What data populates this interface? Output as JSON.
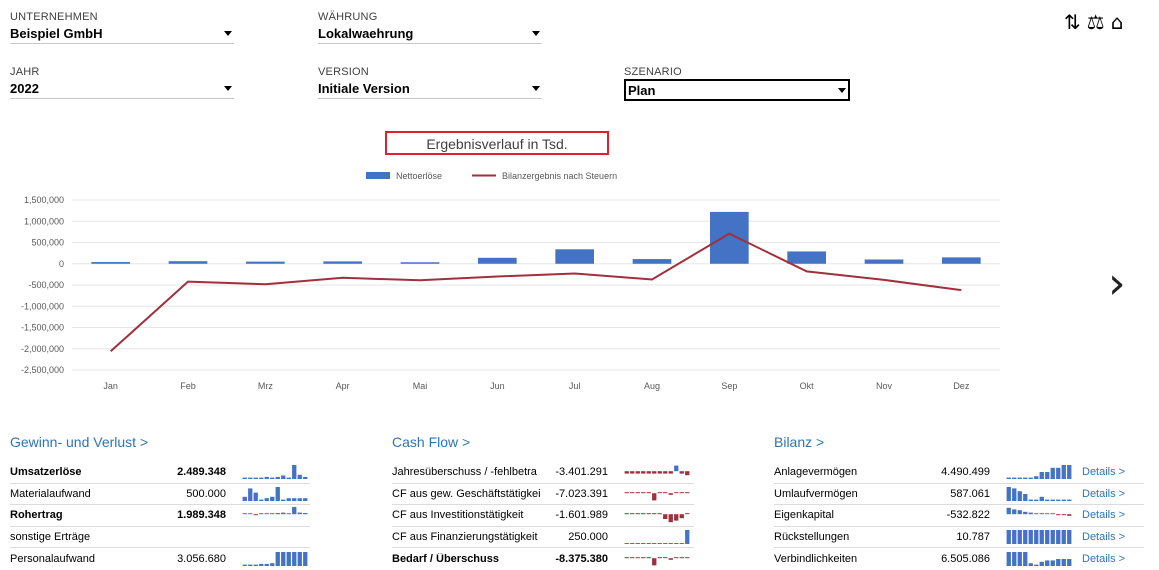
{
  "filters": {
    "unternehmen": {
      "label": "UNTERNEHMEN",
      "value": "Beispiel GmbH"
    },
    "waehrung": {
      "label": "WÄHRUNG",
      "value": "Lokalwaehrung"
    },
    "jahr": {
      "label": "JAHR",
      "value": "2022"
    },
    "version": {
      "label": "VERSION",
      "value": "Initiale Version"
    },
    "szenario": {
      "label": "SZENARIO",
      "value": "Plan"
    }
  },
  "top_icons": [
    "refresh-arrows-icon",
    "balance-scale-icon",
    "home-icon"
  ],
  "nav_next": "›",
  "chart_data": {
    "type": "bar",
    "title": "Ergebnisverlauf in Tsd.",
    "legend_position": "top",
    "categories": [
      "Jan",
      "Feb",
      "Mrz",
      "Apr",
      "Mai",
      "Jun",
      "Jul",
      "Aug",
      "Sep",
      "Okt",
      "Nov",
      "Dez"
    ],
    "y_ticks": [
      "1,500,000",
      "1,000,000",
      "500,000",
      "0",
      "-500,000",
      "-1,000,000",
      "-1,500,000",
      "-2,000,000",
      "-2,500,000"
    ],
    "ylim": [
      -2500000,
      1500000
    ],
    "grid": true,
    "series": [
      {
        "name": "Nettoerlöse",
        "type": "bar",
        "color": "#4472c4",
        "values": [
          40000,
          60000,
          50000,
          55000,
          35000,
          140000,
          340000,
          110000,
          1220000,
          290000,
          100000,
          150000
        ]
      },
      {
        "name": "Bilanzergebnis nach Steuern",
        "type": "line",
        "color": "#a0303c",
        "values": [
          -2060000,
          -420000,
          -480000,
          -330000,
          -390000,
          -300000,
          -230000,
          -370000,
          710000,
          -180000,
          -380000,
          -620000
        ]
      }
    ]
  },
  "sections": {
    "guv": {
      "title": "Gewinn- und Verlust >",
      "rows": [
        {
          "label": "Umsatzerlöse",
          "value": "2.489.348",
          "bold": true,
          "spark": [
            0.1,
            0.1,
            0.1,
            0.1,
            0.15,
            0.1,
            0.15,
            0.25,
            0.1,
            1.0,
            0.3,
            0.15
          ],
          "spark_color": "#4472c4"
        },
        {
          "label": "Materialaufwand",
          "value": "500.000",
          "bold": false,
          "spark": [
            0.3,
            0.9,
            0.6,
            0.1,
            0.2,
            0.3,
            1.0,
            0.1,
            0.2,
            0.2,
            0.2,
            0.2
          ],
          "spark_color": "#4472c4"
        },
        {
          "label": "Rohertrag",
          "value": "1.989.348",
          "bold": true,
          "spark": [
            0.1,
            0.1,
            -0.1,
            0.1,
            0.1,
            0.1,
            0.15,
            0.2,
            0.1,
            1.0,
            0.2,
            0.15
          ],
          "spark_color": "#4472c4"
        },
        {
          "label": "sonstige Erträge",
          "value": "",
          "bold": false,
          "spark": null
        },
        {
          "label": "Personalaufwand",
          "value": "3.056.680",
          "bold": false,
          "spark": [
            0.1,
            0.1,
            0.1,
            0.15,
            0.15,
            0.2,
            1.0,
            1.0,
            1.0,
            1.0,
            1.0,
            1.0
          ],
          "spark_color": "#4472c4"
        }
      ]
    },
    "cashflow": {
      "title": "Cash Flow >",
      "rows": [
        {
          "label": "Jahresüberschuss / -fehlbetra",
          "value": "-3.401.291",
          "bold": false,
          "spark": [
            -0.3,
            -0.3,
            -0.3,
            -0.3,
            -0.3,
            -0.3,
            -0.3,
            -0.3,
            -0.3,
            0.7,
            -0.3,
            -0.5
          ],
          "spark_color": "#a0303c"
        },
        {
          "label": "CF aus gew. Geschäftstätigkei",
          "value": "-7.023.391",
          "bold": false,
          "spark": [
            0.1,
            0.1,
            0.1,
            0.1,
            0.1,
            -0.9,
            0.1,
            0.1,
            -0.2,
            0.1,
            0.1,
            0.1
          ],
          "spark_color": "#a0303c"
        },
        {
          "label": "CF aus Investitionstätigkeit",
          "value": "-1.601.989",
          "bold": false,
          "spark": [
            0.0,
            0.0,
            0.0,
            0.0,
            0.0,
            0.05,
            0.1,
            -0.6,
            -1.0,
            -0.8,
            -0.5,
            0.1
          ],
          "spark_color": "#a0303c"
        },
        {
          "label": "CF aus Finanzierungstätigkeit",
          "value": "250.000",
          "bold": false,
          "spark": [
            0,
            0,
            0,
            0,
            0,
            0,
            0,
            0,
            0,
            0,
            0,
            1.0
          ],
          "spark_color": "#4472c4"
        },
        {
          "label": "Bedarf / Überschuss",
          "value": "-8.375.380",
          "bold": true,
          "spark": [
            0.1,
            0.1,
            0.1,
            0.1,
            0.1,
            -0.9,
            0.1,
            0.1,
            -0.2,
            0.1,
            0.1,
            0.1
          ],
          "spark_color": "#a0303c"
        }
      ]
    },
    "bilanz": {
      "title": "Bilanz >",
      "details_label": "Details >",
      "rows": [
        {
          "label": "Anlagevermögen",
          "value": "4.490.499",
          "bold": false,
          "spark": [
            0.1,
            0.1,
            0.1,
            0.1,
            0.1,
            0.2,
            0.5,
            0.5,
            0.8,
            0.8,
            1.0,
            1.0
          ],
          "spark_color": "#4472c4"
        },
        {
          "label": "Umlaufvermögen",
          "value": "587.061",
          "bold": false,
          "spark": [
            1.0,
            0.9,
            0.7,
            0.5,
            0.1,
            0.1,
            0.3,
            0.1,
            0.1,
            0.1,
            0.1,
            0.1
          ],
          "spark_color": "#4472c4"
        },
        {
          "label": "Eigenkapital",
          "value": "-532.822",
          "bold": false,
          "spark": [
            0.8,
            0.6,
            0.5,
            0.3,
            0.2,
            0.1,
            0.1,
            0.05,
            0.05,
            -0.1,
            -0.1,
            -0.2
          ],
          "spark_color": "#4472c4"
        },
        {
          "label": "Rückstellungen",
          "value": "10.787",
          "bold": false,
          "spark": [
            1,
            1,
            1,
            1,
            1,
            1,
            1,
            1,
            1,
            1,
            1,
            1
          ],
          "spark_color": "#4472c4"
        },
        {
          "label": "Verbindlichkeiten",
          "value": "6.505.086",
          "bold": false,
          "spark": [
            1.0,
            1.0,
            1.0,
            1.0,
            0.2,
            0.1,
            0.3,
            0.4,
            0.4,
            0.5,
            0.5,
            0.5
          ],
          "spark_color": "#4472c4"
        }
      ]
    }
  }
}
